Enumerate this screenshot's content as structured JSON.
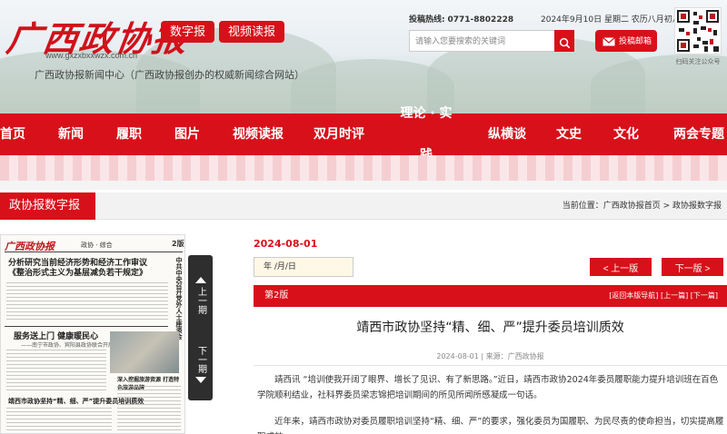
{
  "header": {
    "logo_text": "广西政协报",
    "logo_url": "www.gxzxbxxwzx.com.cn",
    "subtitle": "广西政协报新闻中心（广西政协报创办的权威新闻综合网站）",
    "buttons": {
      "digital": "数字报",
      "video": "视频读报",
      "mail": "投稿邮箱"
    },
    "hotline_label": "投稿热线:",
    "hotline_number": "0771-8802228",
    "date": "2024年9月10日 星期二 农历八月初八",
    "search_placeholder": "请输入您要搜索的关键词",
    "qr_caption": "扫码关注公众号"
  },
  "nav": {
    "items": [
      "首页",
      "新闻",
      "履职",
      "图片",
      "视频读报",
      "双月时评",
      "理论 · 实践",
      "纵横谈",
      "文史",
      "文化",
      "两会专题"
    ]
  },
  "section": {
    "title": "政协报数字报",
    "breadcrumb_prefix": "当前位置：",
    "breadcrumb": "广西政协报首页 > 政协报数字报"
  },
  "newspaper": {
    "masthead": "广西政协报",
    "section": "政协 · 综合",
    "page_no": "2版",
    "headline1": "分析研究当前经济形势和经济工作审议《整治形式主义为基层减负若干规定》",
    "vertical_headline": "中共中央召开党外人士座谈会",
    "headline2": "服务送上门  健康暖民心",
    "headline2_sub": "——南宁市政协、宾阳县政协联合开展义诊活动",
    "headline3": "深入挖掘旅游资源  打造特色旅游品牌",
    "headline4": "靖西市政协坚持“精、细、严”提升委员培训质效",
    "prev_label": "上一期",
    "next_label": "下一期"
  },
  "issue": {
    "date": "2024-08-01",
    "date_field": "年 /月/日",
    "prev_edition": "< 上一版",
    "next_edition": "下一版 >",
    "edition_name": "第2版",
    "edition_links": "[返回本版导航]  [上一篇]  [下一篇]"
  },
  "article": {
    "title": "靖西市政协坚持“精、细、严”提升委员培训质效",
    "meta": "2024-08-01 | 来源：广西政协报",
    "paragraphs": [
      "靖西讯  “培训使我开阔了眼界、增长了见识、有了新思路。”近日，靖西市政协2024年委员履职能力提升培训班在百色学院顺利结业，社科界委员梁志锦把培训期间的所见所闻所感凝成一句话。",
      "近年来，靖西市政协对委员履职培训坚持“精、细、严”的要求，强化委员为国履职、为民尽责的使命担当，切实提高履职成效。"
    ]
  },
  "colors": {
    "brand_red": "#d8101a",
    "dark_pager": "#2e2e2e"
  },
  "icons": {
    "search": "search-icon",
    "mail": "mail-icon",
    "qr": "qr-code-icon"
  }
}
